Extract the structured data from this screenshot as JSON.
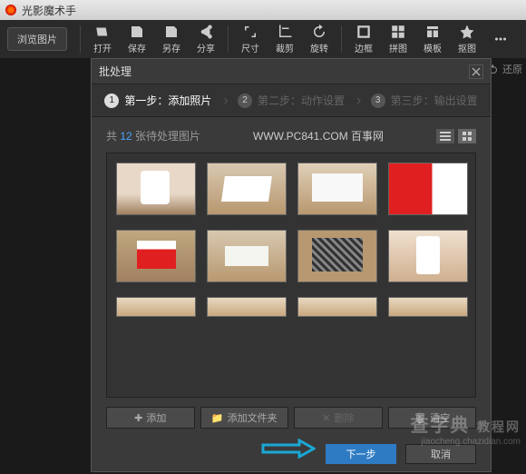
{
  "app": {
    "title": "光影魔术手"
  },
  "toolbar": {
    "browse": "浏览图片",
    "items": [
      {
        "label": "打开",
        "icon": "open"
      },
      {
        "label": "保存",
        "icon": "save"
      },
      {
        "label": "另存",
        "icon": "saveas"
      },
      {
        "label": "分享",
        "icon": "share"
      },
      {
        "label": "尺寸",
        "icon": "size"
      },
      {
        "label": "裁剪",
        "icon": "crop"
      },
      {
        "label": "旋转",
        "icon": "rotate"
      },
      {
        "label": "边框",
        "icon": "border"
      },
      {
        "label": "拼图",
        "icon": "collage"
      },
      {
        "label": "模板",
        "icon": "template"
      },
      {
        "label": "抠图",
        "icon": "cutout"
      },
      {
        "label": "",
        "icon": "more"
      }
    ],
    "right_label": "还原"
  },
  "dialog": {
    "title": "批处理",
    "steps": [
      {
        "num": "1",
        "label": "第一步：添加照片",
        "active": true
      },
      {
        "num": "2",
        "label": "第二步：动作设置",
        "active": false
      },
      {
        "num": "3",
        "label": "第三步：输出设置",
        "active": false
      }
    ],
    "count_prefix": "共 ",
    "count": "12",
    "count_suffix": " 张待处理图片",
    "site": "WWW.PC841.COM 百事网",
    "buttons": {
      "add": "添加",
      "add_folder": "添加文件夹",
      "delete": "删除",
      "clear": "清空"
    },
    "footer": {
      "next": "下一步",
      "cancel": "取消"
    }
  },
  "watermark": {
    "main": "查字典",
    "sub": "教程网",
    "url": "jiaocheng.chazidian.com"
  }
}
